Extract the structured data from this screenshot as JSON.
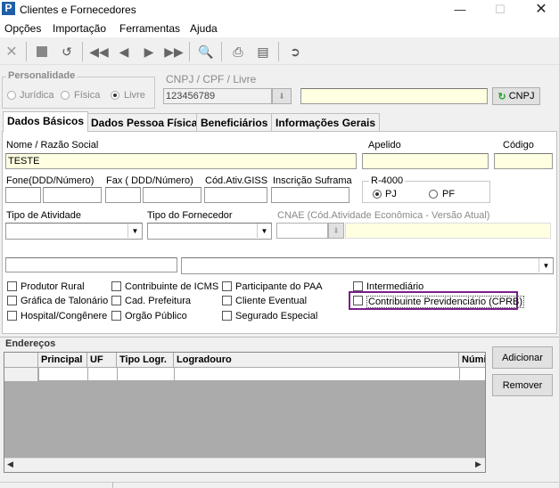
{
  "window": {
    "title": "Clientes e Fornecedores",
    "app_icon_letter": "P"
  },
  "menu": [
    "Opções",
    "Importação",
    "Ferramentas",
    "Ajuda"
  ],
  "toolbar_icons": [
    "cancel-icon",
    "stop-icon",
    "undo-icon",
    "first-record-icon",
    "previous-record-icon",
    "next-record-icon",
    "last-record-icon",
    "search-icon",
    "print-icon",
    "preview-icon",
    "exit-icon"
  ],
  "personalidade": {
    "title": "Personalidade",
    "options": [
      "Jurídica",
      "Física",
      "Livre"
    ],
    "selected": "Livre"
  },
  "cnpj": {
    "label": "CNPJ / CPF / Livre",
    "value": "123456789",
    "name_value": "",
    "button_label": "CNPJ"
  },
  "tabs": [
    "Dados Básicos",
    "Dados Pessoa Física",
    "Beneficiários",
    "Informações Gerais"
  ],
  "active_tab": "Dados Básicos",
  "fields": {
    "nome_label": "Nome / Razão Social",
    "nome_value": "TESTE",
    "apelido_label": "Apelido",
    "apelido_value": "",
    "codigo_label": "Código",
    "codigo_value": "",
    "fone_label": "Fone(DDD/Número)",
    "fax_label": "Fax ( DDD/Número)",
    "giss_label": "Cód.Ativ.GISS",
    "suframa_label": "Inscrição Suframa",
    "r4000_title": "R-4000",
    "r4000_options": [
      "PJ",
      "PF"
    ],
    "r4000_selected": "PJ",
    "tipo_atividade_label": "Tipo de Atividade",
    "tipo_fornecedor_label": "Tipo do Fornecedor",
    "cnae_label": "CNAE (Cód.Atividade Econômica - Versão Atual)"
  },
  "checkboxes": [
    [
      "Produtor Rural",
      "Gráfica de Talonário",
      "Hospital/Congênere"
    ],
    [
      "Contribuinte de ICMS",
      "Cad. Prefeitura",
      "Orgão Público"
    ],
    [
      "Participante do PAA",
      "Cliente Eventual",
      "Segurado Especial"
    ],
    [
      "Intermediário",
      "Contribuinte Previdenciário (CPRB)"
    ]
  ],
  "enderecos": {
    "title": "Endereços",
    "columns": [
      "Principal",
      "UF",
      "Tipo Logr.",
      "Logradouro",
      "Númi"
    ],
    "add_button": "Adicionar",
    "remove_button": "Remover"
  },
  "colors": {
    "highlight_border": "#7b1e8c",
    "yellow_field": "#ffffe1",
    "cnpj_icon": "#2aa02a"
  }
}
